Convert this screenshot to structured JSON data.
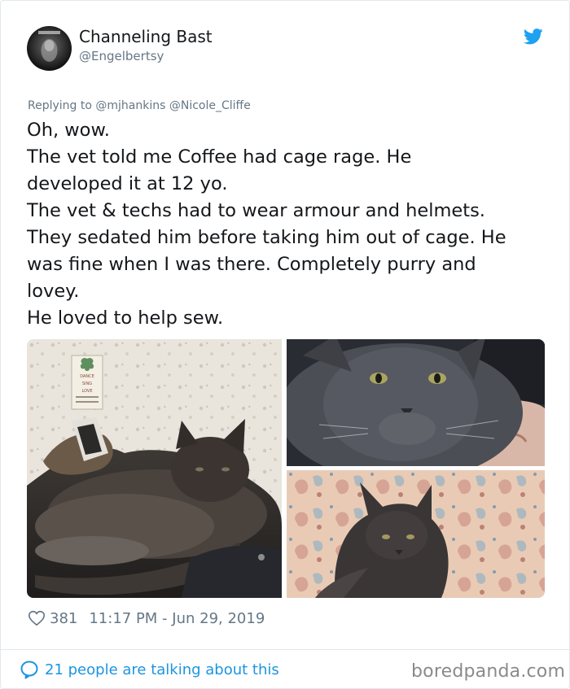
{
  "author": {
    "display_name": "Channeling Bast",
    "handle": "@Engelbertsy"
  },
  "reply": {
    "prefix": "Replying to",
    "mentions": [
      "@mjhankins",
      "@Nicole_Cliffe"
    ]
  },
  "tweet": {
    "lines": [
      "Oh, wow.",
      "The vet told me Coffee had cage rage. He",
      "developed it at 12 yo.",
      "The vet & techs had to wear armour and helmets.",
      "They sedated him before taking him out of cage. He",
      "was fine when I was there. Completely purry and",
      "lovey.",
      "He loved to help sew."
    ]
  },
  "sign_text": [
    "DANCE",
    "SING",
    "LOVE"
  ],
  "stats": {
    "likes": "381",
    "timestamp": "11:17 PM - Jun 29, 2019"
  },
  "footer": {
    "talking": "21 people are talking about this",
    "watermark": "boredpanda.com"
  },
  "colors": {
    "accent": "#1b95e0",
    "twitter_blue": "#1da1f2",
    "secondary_text": "#657786"
  },
  "icons": {
    "brand": "twitter-bird-icon",
    "like": "heart-icon",
    "conversation": "speech-bubble-icon"
  }
}
